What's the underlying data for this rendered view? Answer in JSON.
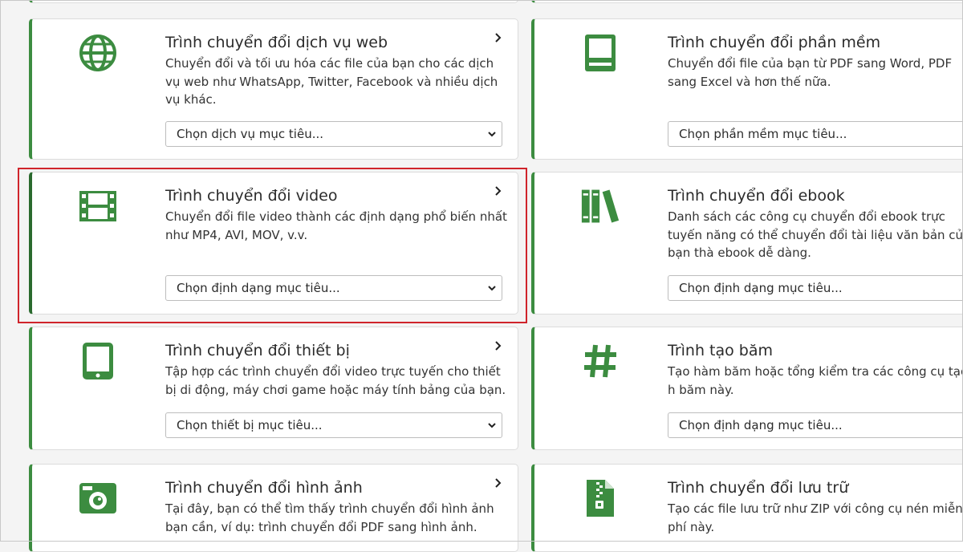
{
  "cards_left": [
    {
      "title": "Trình chuyển đổi dịch vụ web",
      "desc": "Chuyển đổi và tối ưu hóa các file của bạn cho các dịch vụ web như WhatsApp, Twitter, Facebook và nhiều dịch vụ khác.",
      "select": "Chọn dịch vụ mục tiêu...",
      "icon": "globe-icon"
    },
    {
      "title": "Trình chuyển đổi video",
      "desc": "Chuyển đổi file video thành các định dạng phổ biến nhất như MP4, AVI, MOV, v.v.",
      "select": "Chọn định dạng mục tiêu...",
      "icon": "film-icon"
    },
    {
      "title": "Trình chuyển đổi thiết bị",
      "desc": "Tập hợp các trình chuyển đổi video trực tuyến cho thiết bị di động, máy chơi game hoặc máy tính bảng của bạn.",
      "select": "Chọn thiết bị mục tiêu...",
      "icon": "tablet-icon"
    },
    {
      "title": "Trình chuyển đổi hình ảnh",
      "desc": "Tại đây, bạn có thể tìm thấy trình chuyển đổi hình ảnh bạn cần, ví dụ: trình chuyển đổi PDF sang hình ảnh.",
      "icon": "camera-icon"
    }
  ],
  "cards_right": [
    {
      "title": "Trình chuyển đổi phần mềm",
      "desc": "Chuyển đổi file của bạn từ PDF sang Word, PDF sang Excel và hơn thế nữa.",
      "select": "Chọn phần mềm mục tiêu...",
      "icon": "monitor-icon"
    },
    {
      "title": "Trình chuyển đổi ebook",
      "desc": "Danh sách các công cụ chuyển đổi ebook trực tuyến năng có thể chuyển đổi tài liệu văn bản của bạn thà ebook dễ dàng.",
      "select": "Chọn định dạng mục tiêu...",
      "icon": "books-icon"
    },
    {
      "title": "Trình tạo băm",
      "desc": "Tạo hàm băm hoặc tổng kiểm tra các công cụ tạo h băm này.",
      "select": "Chọn định dạng mục tiêu...",
      "icon": "hash-icon"
    },
    {
      "title": "Trình chuyển đổi lưu trữ",
      "desc": "Tạo các file lưu trữ như ZIP với công cụ nén miễn phí này.",
      "icon": "zip-file-icon"
    }
  ],
  "colors": {
    "accent": "#3c8c40",
    "highlight": "#d0242b"
  }
}
